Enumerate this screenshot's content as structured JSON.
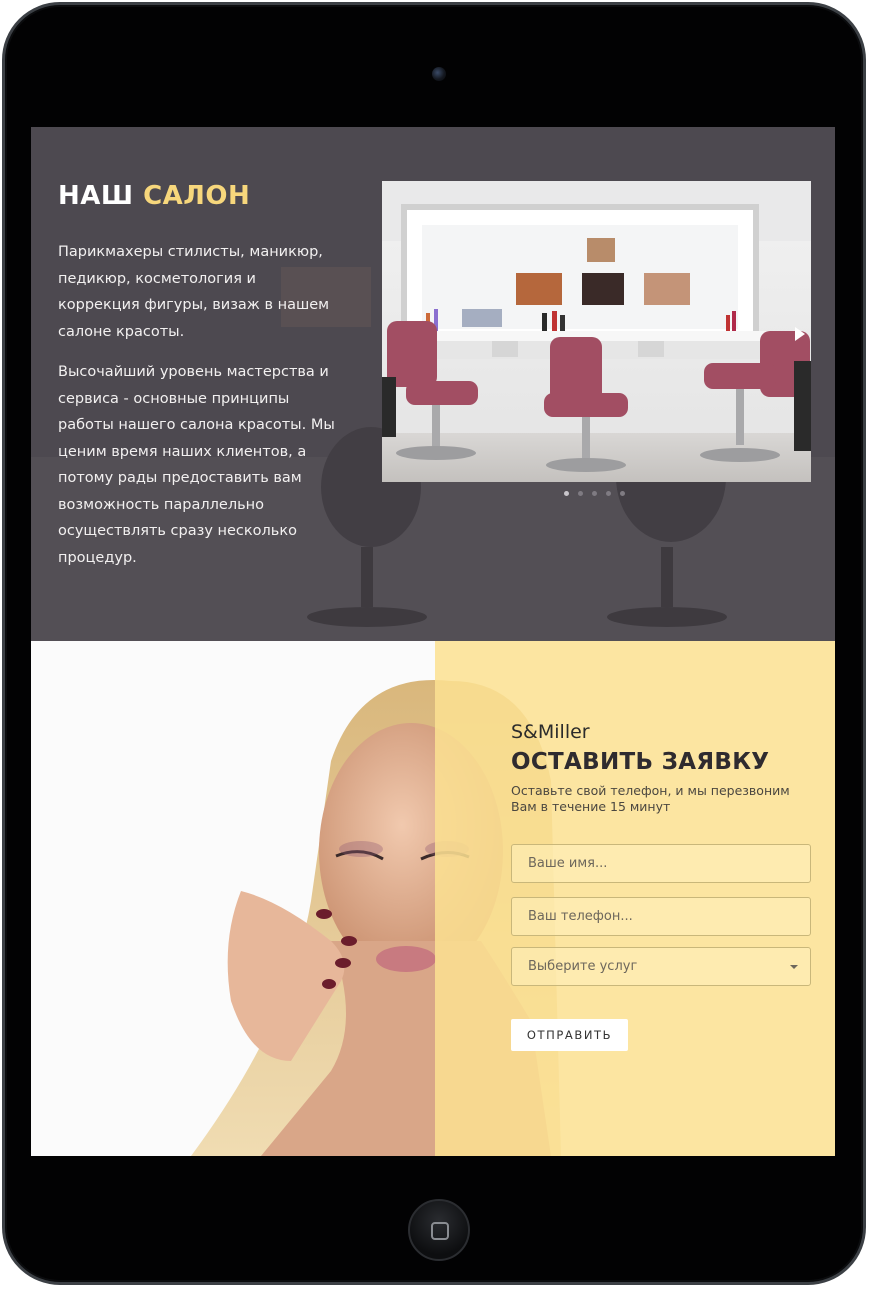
{
  "salon": {
    "title_part1": "НАШ",
    "title_part2": "САЛОН",
    "paragraph1": "Парикмахеры стилисты, маникюр, педикюр, косметология и коррекция фигуры, визаж в нашем салоне красоты.",
    "paragraph2": "Высочайший уровень мастерства и сервиса - основные принципы работы нашего салона красоты. Мы ценим время наших клиентов, а потому рады предоставить вам возможность параллельно осуществлять сразу несколько процедур."
  },
  "slider": {
    "slide_count": 5,
    "active_slide": 1
  },
  "form": {
    "brand": "S&Miller",
    "title": "ОСТАВИТЬ ЗАЯВКУ",
    "subtitle": "Оставьте свой телефон, и мы перезвоним Вам в течение 15 минут",
    "name_placeholder": "Ваше имя...",
    "phone_placeholder": "Ваш телефон...",
    "service_select_value": "Выберите услуг",
    "submit_label": "ОТПРАВИТЬ"
  },
  "colors": {
    "accent_yellow": "#f7d77c",
    "panel_yellow": "#fbe191",
    "salon_bg": "#47434a",
    "chair": "#a24e63"
  },
  "icons": {
    "next_arrow": "play-triangle-icon",
    "select_caret": "chevron-down-icon",
    "home_button": "home-square-icon"
  }
}
